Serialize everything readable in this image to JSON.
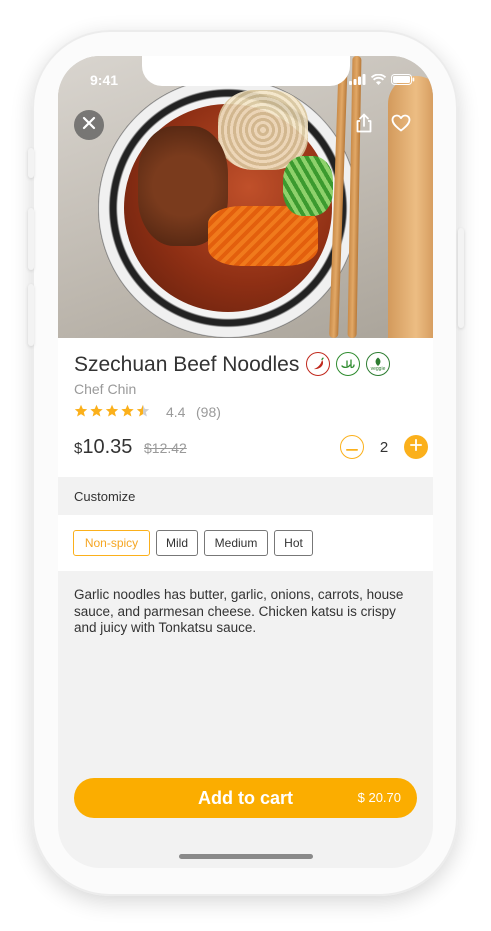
{
  "status_bar": {
    "time": "9:41"
  },
  "product": {
    "name": "Szechuan Beef Noodles",
    "badges": [
      "spicy-badge-icon",
      "halal-badge-icon",
      "veggie-badge-icon"
    ],
    "veggie_badge_text": "veggie",
    "chef": "Chef Chin",
    "rating": "4.4",
    "rating_value": 4.4,
    "rating_count": "(98)",
    "currency": "$",
    "price": "10.35",
    "old_price": "$12.42",
    "quantity": "2"
  },
  "customize": {
    "label": "Customize",
    "options": [
      "Non-spicy",
      "Mild",
      "Medium",
      "Hot"
    ],
    "selected": "Non-spicy"
  },
  "description": "Garlic noodles has butter, garlic, onions, carrots, house sauce, and parmesan cheese. Chicken katsu is crispy and juicy with Tonkatsu sauce.",
  "cart": {
    "label": "Add to cart",
    "total": "$ 20.70"
  },
  "colors": {
    "accent": "#fbad00",
    "spicy": "#c0281c",
    "halal": "#2e8b2e",
    "veggie": "#2e7d32"
  }
}
